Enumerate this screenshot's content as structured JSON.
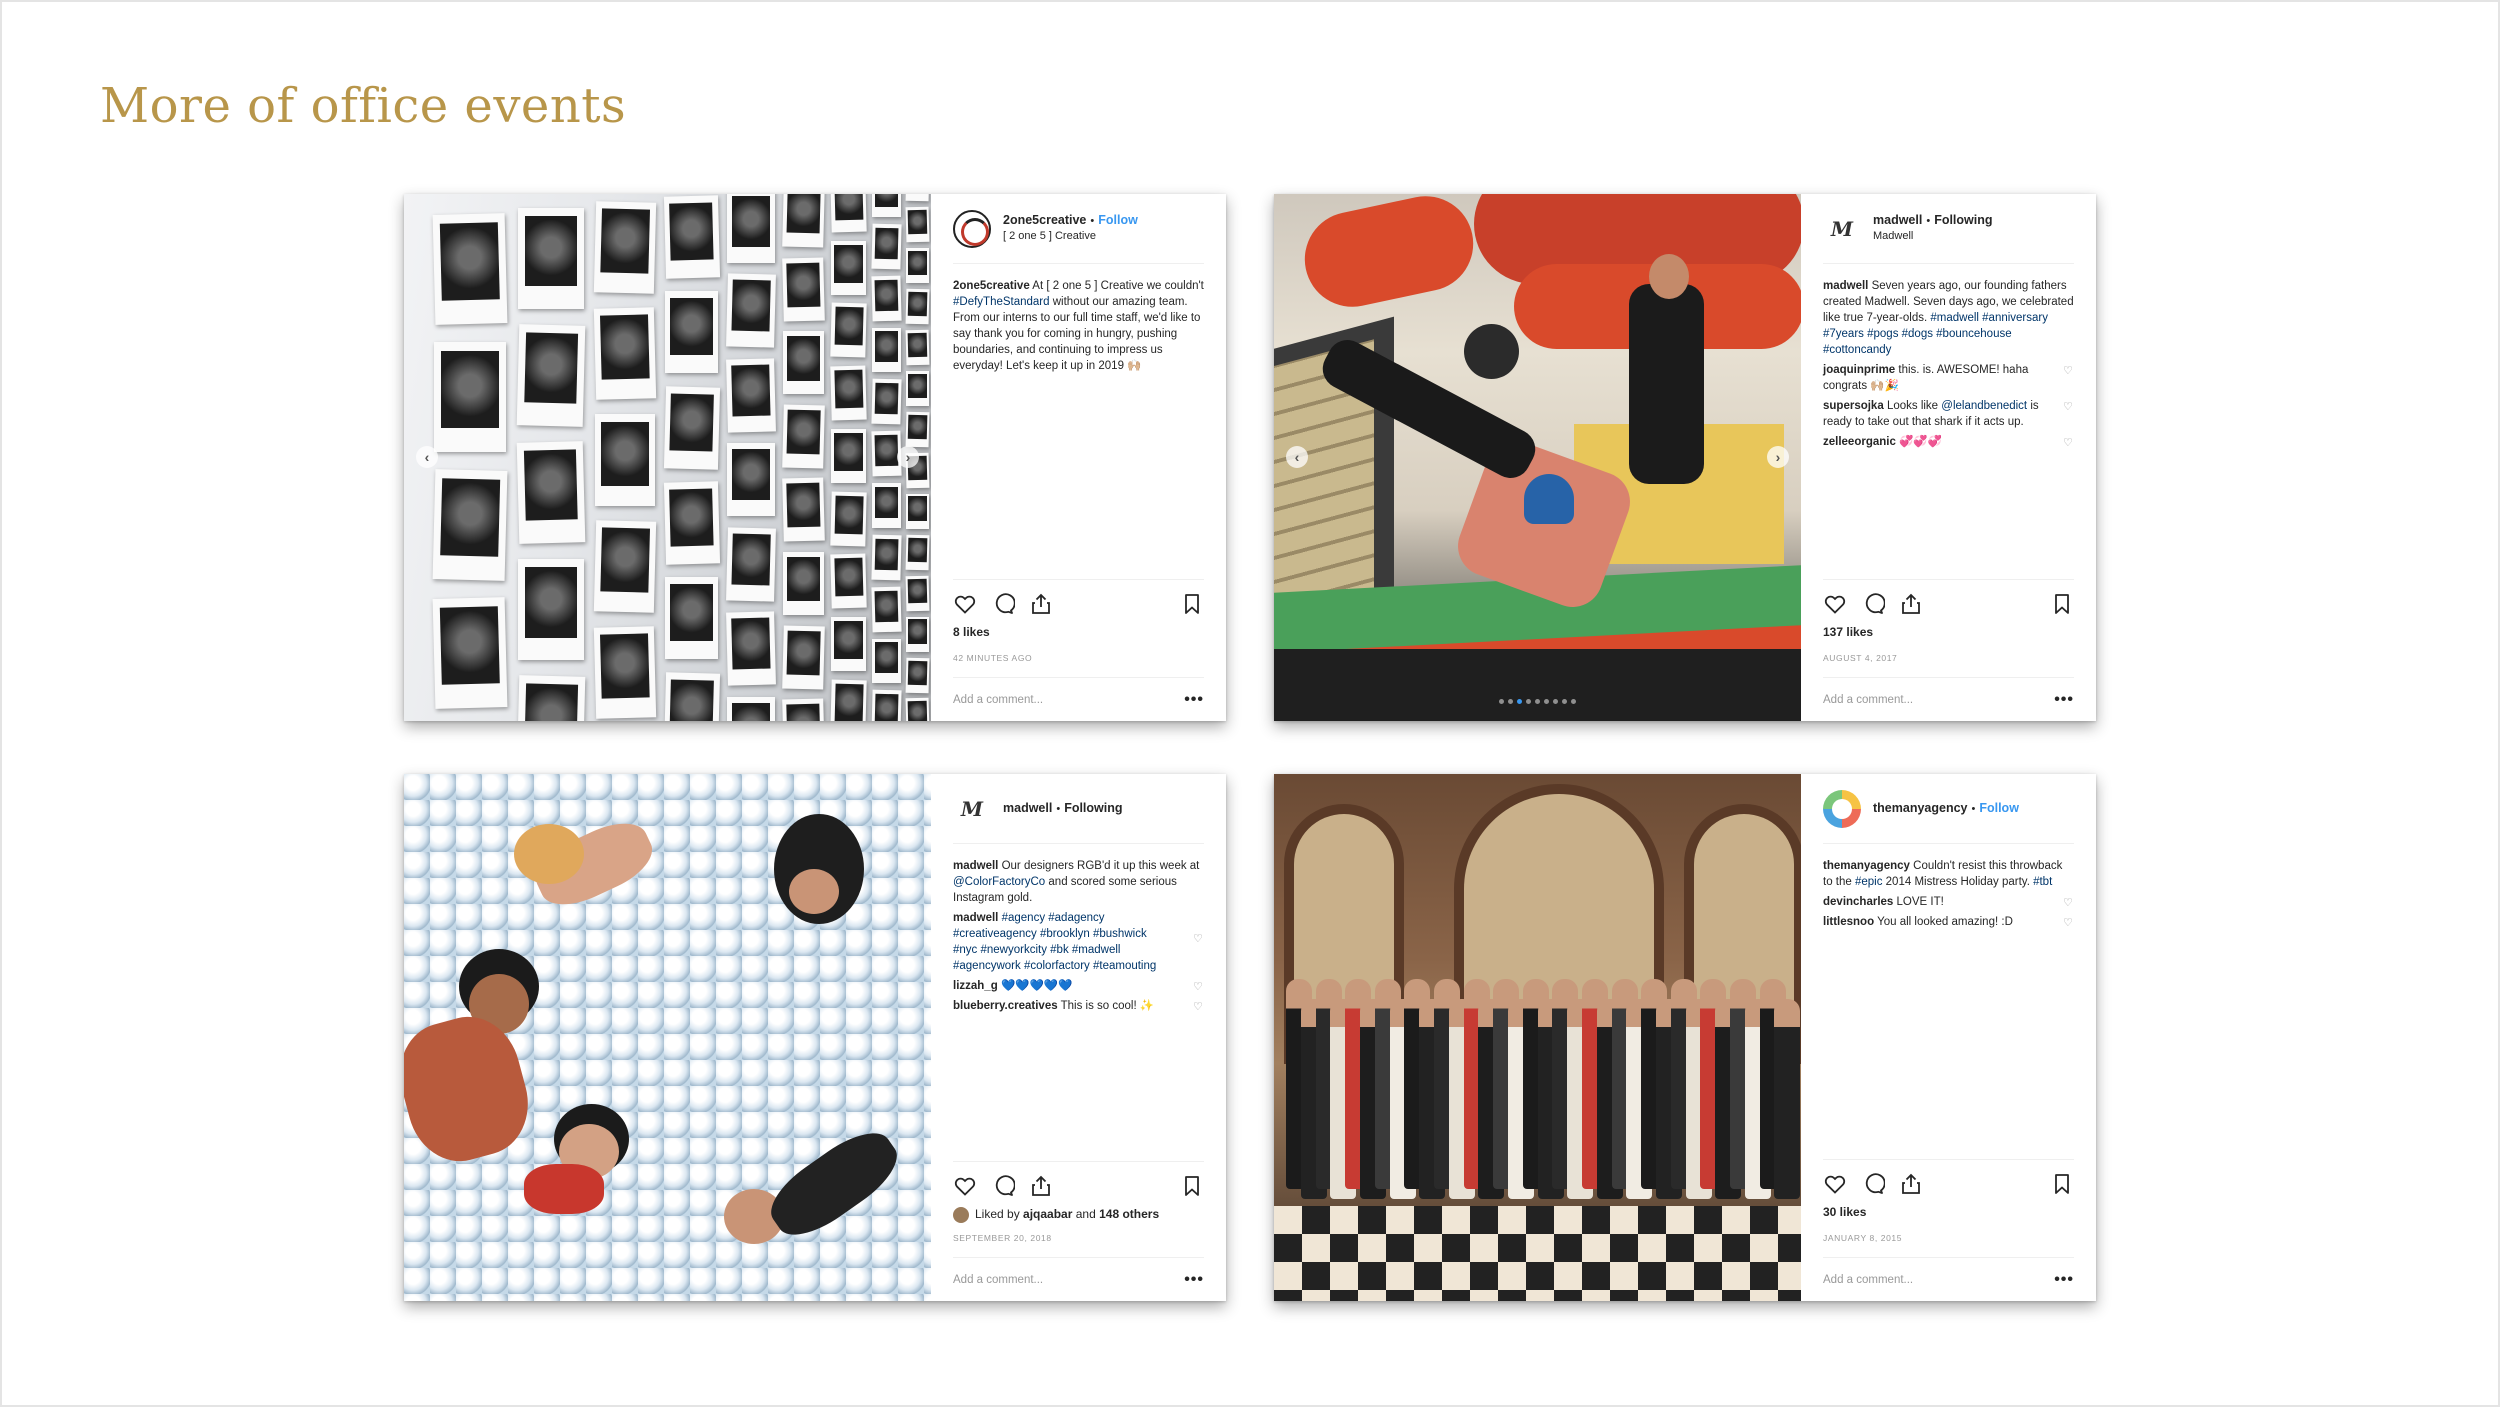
{
  "slide": {
    "title": "More of office events"
  },
  "posts": [
    {
      "username": "2one5creative",
      "dot": "•",
      "relation": "Follow",
      "subtitle": "[ 2 one 5 ] Creative",
      "caption_user": "2one5creative",
      "caption_text_1": "At [ 2 one 5 ] Creative we couldn't ",
      "caption_tag_1": "#DefyTheStandard",
      "caption_text_2": " without our amazing team. From our interns to our full time staff, we'd like to say thank you for coming in hungry, pushing boundaries, and continuing to impress us everyday! Let's keep it up in 2019 🙌🏼",
      "likes": "8 likes",
      "date": "42 minutes ago",
      "add_comment": "Add a comment...",
      "more": "•••"
    },
    {
      "username": "madwell",
      "dot": "•",
      "relation": "Following",
      "subtitle": "Madwell",
      "caption_user": "madwell",
      "caption_text_1": "Seven years ago, our founding fathers created Madwell. Seven days ago, we celebrated like true 7-year-olds. ",
      "caption_tags": "#madwell #anniversary #7years #pogs #dogs #bouncehouse #cottoncandy",
      "comments": [
        {
          "user": "joaquinprime",
          "text": "this. is. AWESOME! haha congrats 🙌🏼🎉"
        },
        {
          "user": "supersojka",
          "text_1": "Looks like ",
          "mention": "@lelandbenedict",
          "text_2": " is ready to take out that shark if it acts up."
        },
        {
          "user": "zelleeorganic",
          "text": "💞💞💞"
        }
      ],
      "likes": "137 likes",
      "date": "August 4, 2017",
      "add_comment": "Add a comment...",
      "more": "•••"
    },
    {
      "username": "madwell",
      "dot": "•",
      "relation": "Following",
      "caption_user": "madwell",
      "caption_text_1": "Our designers RGB'd it up this week at ",
      "caption_mention": "@ColorFactoryCo",
      "caption_text_2": " and scored some serious Instagram gold.",
      "comments": [
        {
          "user": "madwell",
          "tags": "#agency #adagency #creativeagency #brooklyn #bushwick #nyc #newyorkcity #bk #madwell #agencywork #colorfactory #teamouting"
        },
        {
          "user": "lizzah_g",
          "text": "💙💙💙💙💙"
        },
        {
          "user": "blueberry.creatives",
          "text": "This is so cool! ✨"
        }
      ],
      "liked_by_prefix": "Liked by ",
      "liked_by_user": "ajqaabar",
      "liked_by_suffix": " and ",
      "liked_by_others": "148 others",
      "date": "September 20, 2018",
      "add_comment": "Add a comment...",
      "more": "•••"
    },
    {
      "username": "themanyagency",
      "dot": "•",
      "relation": "Follow",
      "caption_user": "themanyagency",
      "caption_text_1": "Couldn't resist this throwback to the ",
      "caption_tag_1": "#epic",
      "caption_text_2": " 2014 Mistress Holiday party. ",
      "caption_tag_2": "#tbt",
      "comments": [
        {
          "user": "devincharles",
          "text": "LOVE IT!"
        },
        {
          "user": "littlesnoo",
          "text": "You all looked amazing! :D"
        }
      ],
      "likes": "30 likes",
      "date": "January 8, 2015",
      "add_comment": "Add a comment...",
      "more": "•••"
    }
  ],
  "icons": [
    "heart-icon",
    "comment-icon",
    "share-icon",
    "bookmark-icon",
    "chevron-left-icon",
    "chevron-right-icon",
    "more-icon"
  ],
  "colors": {
    "title": "#b8964a",
    "link": "#3897f0",
    "hashtag": "#003569",
    "muted": "#999999"
  }
}
